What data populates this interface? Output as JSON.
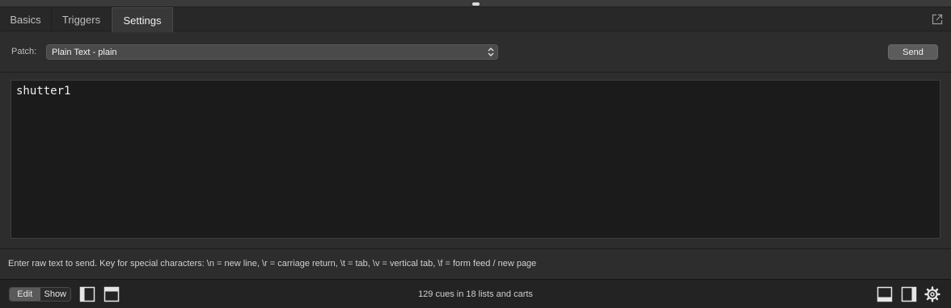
{
  "tabs": [
    {
      "label": "Basics"
    },
    {
      "label": "Triggers"
    },
    {
      "label": "Settings"
    }
  ],
  "active_tab": "Settings",
  "patch": {
    "label": "Patch:",
    "selected": "Plain Text - plain"
  },
  "send_button": "Send",
  "text_content": "shutter1",
  "help_text": "Enter raw text to send. Key for special characters: \\n = new line, \\r = carriage return, \\t = tab, \\v = vertical tab, \\f = form feed / new page",
  "footer": {
    "mode_edit": "Edit",
    "mode_show": "Show",
    "active_mode": "Edit",
    "status": "129 cues in 18 lists and carts"
  },
  "icons": {
    "popout": "popout-icon",
    "select_arrows": "updown-chevron-icon",
    "left_panel": "left-panel-toggle-icon",
    "top_panel": "top-panel-toggle-icon",
    "bottom_panel": "bottom-panel-toggle-icon",
    "right_panel": "right-panel-toggle-icon",
    "settings": "gear-icon"
  },
  "colors": {
    "background": "#2d2d2d",
    "text_area": "#1b1b1b",
    "bottom_bar": "#232323"
  }
}
